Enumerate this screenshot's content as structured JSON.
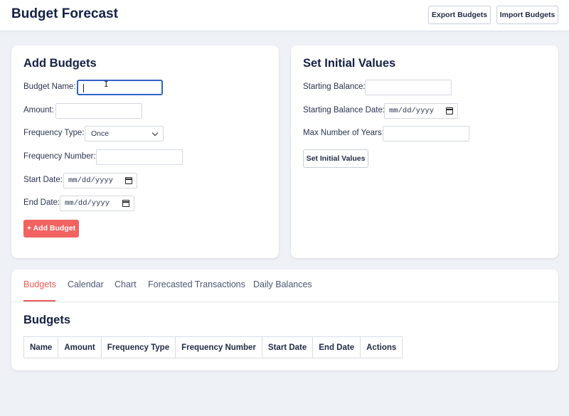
{
  "header": {
    "title": "Budget Forecast",
    "export_label": "Export Budgets",
    "import_label": "Import Budgets"
  },
  "add_budgets": {
    "title": "Add Budgets",
    "budget_name_label": "Budget Name:",
    "budget_name_value": "",
    "amount_label": "Amount:",
    "amount_value": "",
    "frequency_type_label": "Frequency Type:",
    "frequency_type_value": "Once",
    "frequency_number_label": "Frequency Number:",
    "frequency_number_value": "",
    "start_date_label": "Start Date:",
    "start_date_placeholder": "mm/dd/yyyy",
    "end_date_label": "End Date:",
    "end_date_placeholder": "mm/dd/yyyy",
    "add_button_label": "+ Add Budget"
  },
  "initial_values": {
    "title": "Set Initial Values",
    "starting_balance_label": "Starting Balance:",
    "starting_balance_value": "",
    "starting_balance_date_label": "Starting Balance Date:",
    "starting_balance_date_placeholder": "mm/dd/yyyy",
    "max_years_label": "Max Number of Years:",
    "max_years_value": "",
    "set_button_label": "Set Initial Values"
  },
  "tabs": [
    {
      "label": "Budgets",
      "active": true
    },
    {
      "label": "Calendar",
      "active": false
    },
    {
      "label": "Chart",
      "active": false
    },
    {
      "label": "Forecasted Transactions",
      "active": false
    },
    {
      "label": "Daily Balances",
      "active": false
    }
  ],
  "budgets_section": {
    "title": "Budgets",
    "columns": [
      "Name",
      "Amount",
      "Frequency Type",
      "Frequency Number",
      "Start Date",
      "End Date",
      "Actions"
    ]
  },
  "colors": {
    "accent": "#ef5a55",
    "focus": "#2e63c9",
    "background": "#eef1f6"
  }
}
